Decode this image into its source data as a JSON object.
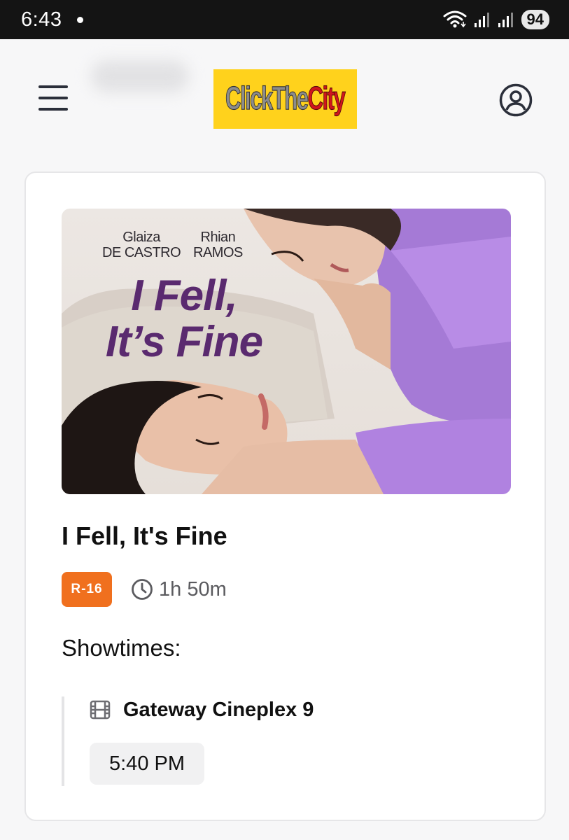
{
  "status_bar": {
    "time": "6:43",
    "battery": "94"
  },
  "header": {
    "logo_text_part1": "Click",
    "logo_text_part2": "The",
    "logo_text_part3": "City"
  },
  "movie": {
    "poster": {
      "actor1_first": "Glaiza",
      "actor1_last": "DE CASTRO",
      "actor2_first": "Rhian",
      "actor2_last": "RAMOS",
      "title_line1": "I Fell,",
      "title_line2": "It’s Fine"
    },
    "title": "I Fell, It's Fine",
    "rating": "R-16",
    "duration": "1h 50m"
  },
  "showtimes": {
    "heading": "Showtimes:",
    "cinemas": [
      {
        "name": "Gateway Cineplex 9",
        "times": [
          "5:40 PM"
        ]
      }
    ]
  },
  "colors": {
    "rating_badge": "#f0701e",
    "logo_bg": "#ffd21c",
    "logo_red": "#d0161c"
  }
}
